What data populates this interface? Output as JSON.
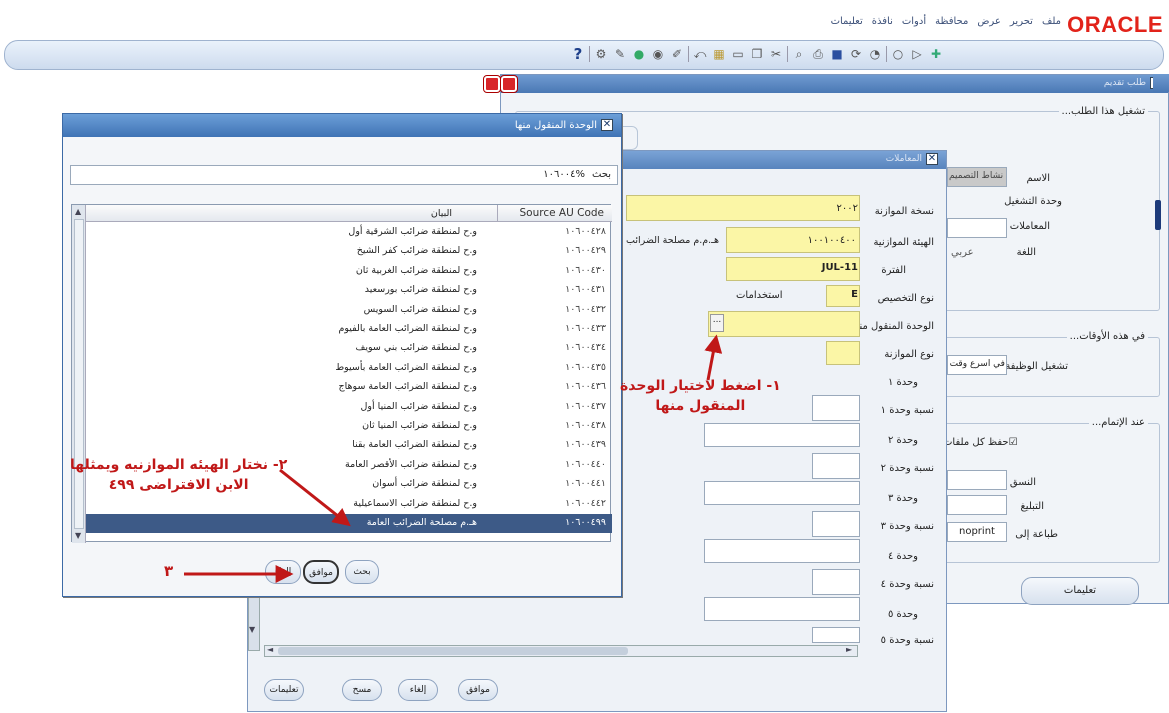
{
  "app": {
    "logo": "ORACLE",
    "menu": [
      "ملف",
      "تحرير",
      "عرض",
      "محافظة",
      "أدوات",
      "نافذة",
      "تعليمات"
    ]
  },
  "request_window": {
    "title": "طلب تقديم",
    "run_this_request": "تشغيل هذا الطلب...",
    "name_label": "الاسم",
    "name_value": "نشاط التصميم",
    "operating_unit_label": "وحدة التشغيل",
    "parameters_label": "المعاملات",
    "language_label": "اللغة",
    "language_value": "عربي",
    "at_these_times": "في هذه الأوقات...",
    "run_job_label": "تشغيل الوظيفة",
    "run_job_value": "في أسرع وقت ممكن",
    "upon_completion": "عند الإتمام...",
    "save_outputs": "حفظ كل ملفات",
    "layout_label": "النسق",
    "notify_label": "التبليغ",
    "print_to_label": "طباعة إلى",
    "print_to_value": "noprint",
    "help_button": "تعليمات"
  },
  "params_window": {
    "title": "المعاملات",
    "fields": {
      "budget_version": {
        "label": "نسخة الموازنة",
        "value": "٢٠٠٢"
      },
      "budget_entity": {
        "label": "الهيئة الموازنية",
        "value": "١٠٠١٠٠٤٠٠",
        "desc": "هـ.م.م مصلحة الضرائب"
      },
      "period": {
        "label": "الفترة",
        "value": "JUL-11"
      },
      "allocation_type": {
        "label": "نوع التخصيص",
        "value": "E",
        "desc": "استخدامات"
      },
      "source_unit": {
        "label": "الوحدة المنقول منها",
        "value": "..."
      },
      "budget_type": {
        "label": "نوع الموازنة",
        "value": ""
      }
    },
    "unit_labels": [
      "وحدة ١",
      "نسبة وحدة ١",
      "وحدة ٢",
      "نسبة وحدة ٢",
      "وحدة ٣",
      "نسبة وحدة ٣",
      "وحدة ٤",
      "نسبة وحدة ٤",
      "وحدة ٥",
      "نسبة وحدة ٥"
    ],
    "buttons": {
      "ok": "موافق",
      "cancel": "إلغاء",
      "clear": "مسح",
      "help": "تعليمات"
    }
  },
  "lov_dialog": {
    "title": "الوحدة المنقول منها",
    "search_label": "بحث",
    "search_value": "%١٠٦٠٠٤",
    "col_name": "البيان",
    "col_code": "Source AU Code",
    "rows": [
      {
        "code": "١٠٦٠٠٤٢٨",
        "name": "و.ح لمنطقة ضرائب الشرقية أول"
      },
      {
        "code": "١٠٦٠٠٤٢٩",
        "name": "و.ح لمنطقة ضرائب كفر الشيخ"
      },
      {
        "code": "١٠٦٠٠٤٣٠",
        "name": "و.ح لمنطقة ضرائب الغربية ثان"
      },
      {
        "code": "١٠٦٠٠٤٣١",
        "name": "و.ح لمنطقة ضرائب بورسعيد"
      },
      {
        "code": "١٠٦٠٠٤٣٢",
        "name": "و.ح لمنطقة ضرائب السويس"
      },
      {
        "code": "١٠٦٠٠٤٣٣",
        "name": "و.ح لمنطقة الضرائب العامة بالفيوم"
      },
      {
        "code": "١٠٦٠٠٤٣٤",
        "name": "و.ح لمنطقة ضرائب بني سويف"
      },
      {
        "code": "١٠٦٠٠٤٣٥",
        "name": "و.ح لمنطقة الضرائب العامة بأسيوط"
      },
      {
        "code": "١٠٦٠٠٤٣٦",
        "name": "و.ح لمنطقة الضرائب العامة سوهاج"
      },
      {
        "code": "١٠٦٠٠٤٣٧",
        "name": "و.ح لمنطقة ضرائب المنيا أول"
      },
      {
        "code": "١٠٦٠٠٤٣٨",
        "name": "و.ح لمنطقة ضرائب المنيا ثان"
      },
      {
        "code": "١٠٦٠٠٤٣٩",
        "name": "و.ح لمنطقة الضرائب العامة بقنا"
      },
      {
        "code": "١٠٦٠٠٤٤٠",
        "name": "و.ح لمنطقة ضرائب الأقصر العامة"
      },
      {
        "code": "١٠٦٠٠٤٤١",
        "name": "و.ح لمنطقة ضرائب أسوان"
      },
      {
        "code": "١٠٦٠٠٤٤٢",
        "name": "و.ح لمنطقة ضرائب الاسماعيلية"
      },
      {
        "code": "١٠٦٠٠٤٩٩",
        "name": "هـ.م مصلحة الضرائب العامة"
      }
    ],
    "selected_index": 15,
    "buttons": {
      "find": "بحث",
      "ok": "موافق",
      "cancel": "إلغاء"
    }
  },
  "annotations": {
    "step1": "١- اضغط لاختيار الوحدة",
    "step1b": "المنقول منها",
    "step2": "٢- نختار الهيئه الموازنيه ويمثلها",
    "step2b": "الابن الافتراضى ٤٩٩",
    "step3": "٣",
    "color": "#c01818"
  }
}
